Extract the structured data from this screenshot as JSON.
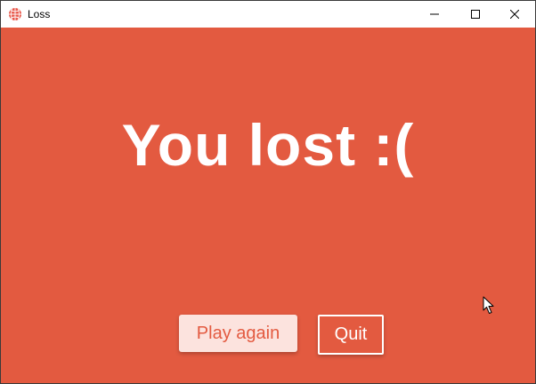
{
  "window": {
    "title": "Loss",
    "icon": "app-icon",
    "controls": {
      "minimize_icon": "minimize-icon",
      "maximize_icon": "maximize-icon",
      "close_icon": "close-icon"
    }
  },
  "main": {
    "headline": "You lost :(",
    "play_again_label": "Play again",
    "quit_label": "Quit"
  },
  "colors": {
    "background": "#E35A40",
    "play_again_bg": "#FCE3DE",
    "text_light": "#FFFFFF"
  },
  "cursor_icon": "mouse-pointer-icon"
}
